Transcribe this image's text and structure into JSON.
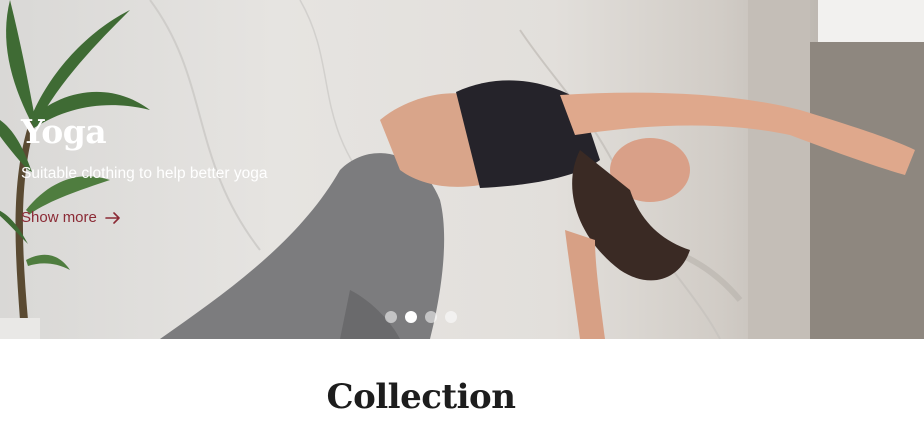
{
  "hero": {
    "title": "Yoga",
    "subtitle": "Suitable clothing to help better yoga",
    "cta_label": "Show more",
    "image_subject": "woman-doing-yoga-backbend",
    "accent_color": "#8b2a35",
    "slides": {
      "count": 4,
      "active_index": 1
    }
  },
  "collection": {
    "title": "Collection"
  },
  "icons": {
    "cta_icon": "arrow-right-icon"
  }
}
